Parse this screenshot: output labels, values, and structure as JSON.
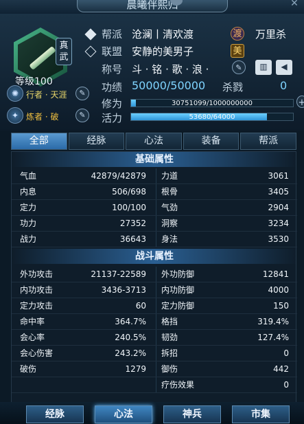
{
  "window": {
    "title": "晨曦伴熙归"
  },
  "profile": {
    "level_label": "等级100",
    "badge_top": "真",
    "badge_bottom": "武",
    "side1_text": "行者 · 天涯",
    "side2_text": "炼者 · 破"
  },
  "fields": {
    "guild_label": "帮派",
    "guild_value": "沧澜丨清欢渡",
    "guild_tag": "渡",
    "guild_extra": "万里杀",
    "alliance_label": "联盟",
    "alliance_value": "安静的美男子",
    "alliance_tag": "美",
    "title_label": "称号",
    "title_value": "斗 · 铭 · 歌 · 浪 ·",
    "merit_label": "功绩",
    "merit_value": "50000/50000",
    "kill_label": "杀戮",
    "kill_value": "0",
    "cultivation_label": "修为",
    "cultivation_text": "30751099/1000000000",
    "cultivation_progress": 0.031,
    "vitality_label": "活力",
    "vitality_text": "53680/64000",
    "vitality_progress": 0.839
  },
  "tabs": [
    "全部",
    "经脉",
    "心法",
    "装备",
    "帮派"
  ],
  "basic": {
    "title": "基础属性",
    "rows": [
      [
        "气血",
        "42879/42879",
        "力道",
        "3061"
      ],
      [
        "内息",
        "506/698",
        "根骨",
        "3405"
      ],
      [
        "定力",
        "100/100",
        "气劲",
        "2904"
      ],
      [
        "功力",
        "27352",
        "洞察",
        "3234"
      ],
      [
        "战力",
        "36643",
        "身法",
        "3530"
      ]
    ]
  },
  "combat": {
    "title": "战斗属性",
    "rows": [
      [
        "外功攻击",
        "21137-22589",
        "外功防御",
        "12841"
      ],
      [
        "内功攻击",
        "3436-3713",
        "内功防御",
        "4000"
      ],
      [
        "定力攻击",
        "60",
        "定力防御",
        "150"
      ],
      [
        "命中率",
        "364.7%",
        "格挡",
        "319.4%"
      ],
      [
        "会心率",
        "240.5%",
        "韧劲",
        "127.4%"
      ],
      [
        "会心伤害",
        "243.2%",
        "拆招",
        "0"
      ],
      [
        "破伤",
        "1279",
        "御伤",
        "442"
      ],
      [
        "",
        "",
        "疗伤效果",
        "0"
      ]
    ]
  },
  "bottom_nav": [
    "经脉",
    "心法",
    "神兵",
    "市集"
  ],
  "colors": {
    "accent": "#5a9ad0",
    "gold": "#e8d66a"
  }
}
